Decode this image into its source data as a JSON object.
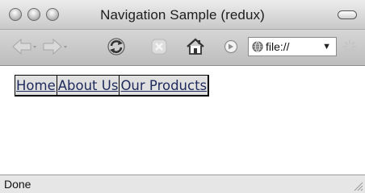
{
  "window": {
    "title": "Navigation Sample (redux)"
  },
  "toolbar": {
    "icons": [
      "back-arrow-icon",
      "forward-arrow-icon",
      "reload-icon",
      "stop-icon",
      "home-icon",
      "go-icon"
    ],
    "address": {
      "text": "file://",
      "dropdown_glyph": "▼",
      "icon": "globe-icon"
    }
  },
  "nav": {
    "items": [
      {
        "label": "Home"
      },
      {
        "label": "About Us"
      },
      {
        "label": "Our Products"
      }
    ]
  },
  "status": {
    "text": "Done"
  },
  "colors": {
    "link": "#1f2a5c",
    "nav_background": "#e0e0e0"
  }
}
